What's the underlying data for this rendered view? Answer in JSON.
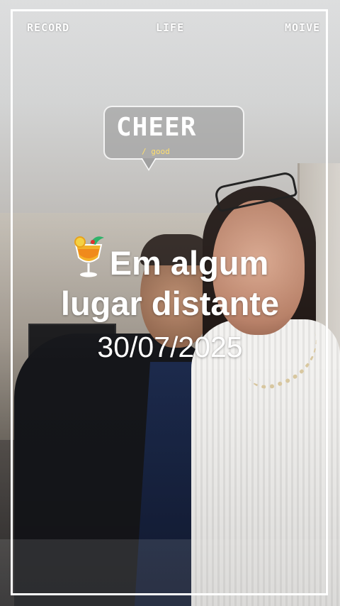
{
  "top_bar": {
    "left_label": "RECORD",
    "center_label": "LIFE",
    "right_label": "MOIVE"
  },
  "sticker": {
    "title": "CHEER",
    "subtitle": "/ good"
  },
  "caption": {
    "line1": "Em algum",
    "line2": "lugar distante",
    "date": "30/07/2025",
    "emoji_icon": "tropical-drink-icon"
  },
  "colors": {
    "frame": "#ffffff",
    "subtitle_accent": "#ffdf6e"
  }
}
